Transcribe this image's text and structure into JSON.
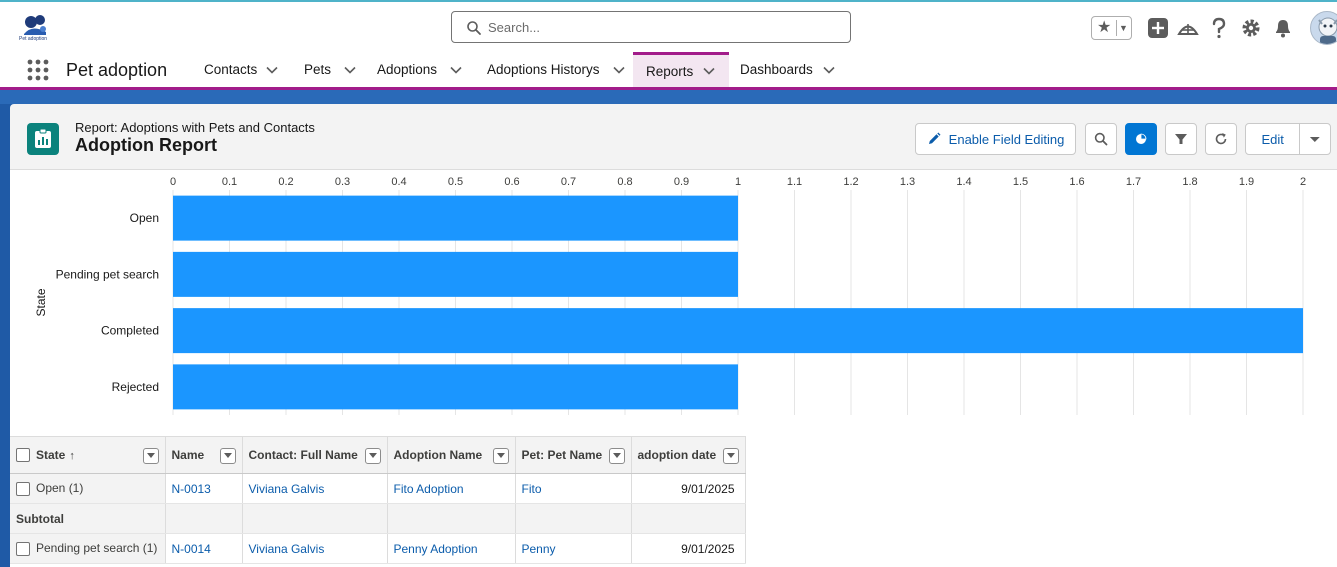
{
  "app": {
    "logo_text": "Pet adoption",
    "name": "Pet adoption"
  },
  "search": {
    "placeholder": "Search..."
  },
  "nav": {
    "items": [
      {
        "label": "Contacts"
      },
      {
        "label": "Pets"
      },
      {
        "label": "Adoptions"
      },
      {
        "label": "Adoptions Historys"
      },
      {
        "label": "Reports",
        "active": true
      },
      {
        "label": "Dashboards"
      }
    ]
  },
  "report": {
    "subtitle": "Report: Adoptions with Pets and Contacts",
    "title": "Adoption Report",
    "enable_field_editing": "Enable Field Editing",
    "edit": "Edit"
  },
  "chart_data": {
    "type": "bar",
    "orientation": "horizontal",
    "categories": [
      "Open",
      "Pending pet search",
      "Completed",
      "Rejected"
    ],
    "values": [
      1,
      1,
      2,
      1
    ],
    "ylabel": "State",
    "xlim": [
      0,
      2
    ],
    "xticks": [
      "0",
      "0.1",
      "0.2",
      "0.3",
      "0.4",
      "0.5",
      "0.6",
      "0.7",
      "0.8",
      "0.9",
      "1",
      "1.1",
      "1.2",
      "1.3",
      "1.4",
      "1.5",
      "1.6",
      "1.7",
      "1.8",
      "1.9",
      "2"
    ],
    "color": "#1b96ff",
    "grid": true
  },
  "table": {
    "headers": [
      "State",
      "Name",
      "Contact: Full Name",
      "Adoption Name",
      "Pet: Pet Name",
      "adoption date"
    ],
    "sort_indicator": "↑",
    "groups": [
      {
        "label": "Open (1)",
        "row": {
          "name": "N-0013",
          "contact": "Viviana Galvis",
          "adoption": "Fito Adoption",
          "pet": "Fito",
          "date": "9/01/2025"
        },
        "subtotal": "Subtotal"
      },
      {
        "label": "Pending pet search (1)",
        "row": {
          "name": "N-0014",
          "contact": "Viviana Galvis",
          "adoption": "Penny Adoption",
          "pet": "Penny",
          "date": "9/01/2025"
        }
      }
    ]
  },
  "colors": {
    "brand": "#0176d3",
    "accent": "#a21c8a",
    "bar": "#1b96ff",
    "link": "#0b5cab"
  }
}
